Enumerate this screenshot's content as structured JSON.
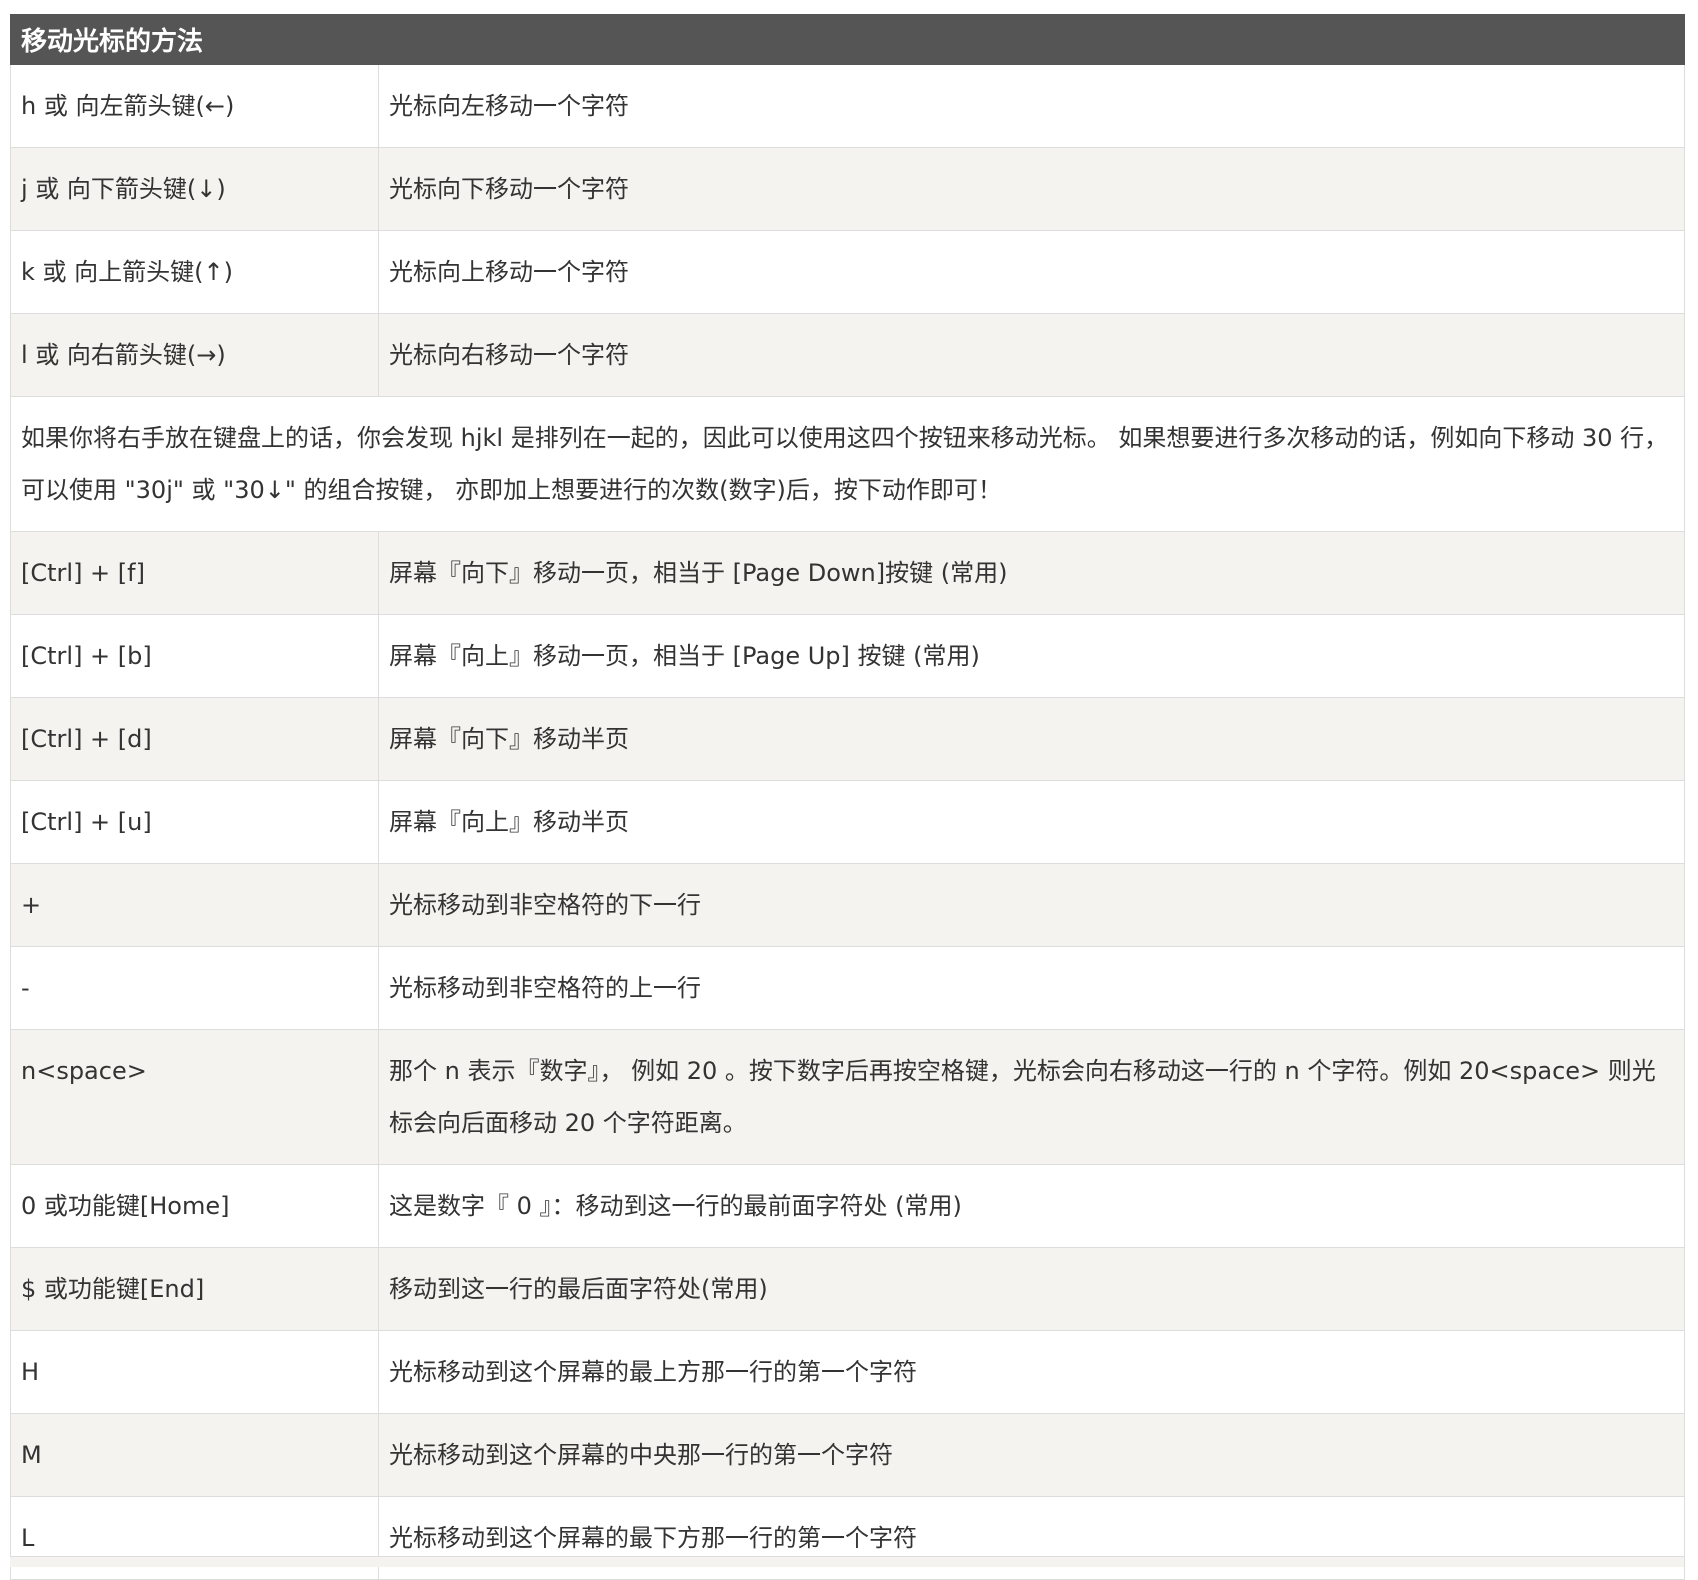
{
  "header": {
    "title": "移动光标的方法"
  },
  "rows": [
    {
      "key": "h 或 向左箭头键(←)",
      "desc": "光标向左移动一个字符"
    },
    {
      "key": "j 或 向下箭头键(↓)",
      "desc": "光标向下移动一个字符"
    },
    {
      "key": "k 或 向上箭头键(↑)",
      "desc": "光标向上移动一个字符"
    },
    {
      "key": "l 或 向右箭头键(→)",
      "desc": "光标向右移动一个字符"
    }
  ],
  "note": "如果你将右手放在键盘上的话，你会发现 hjkl 是排列在一起的，因此可以使用这四个按钮来移动光标。 如果想要进行多次移动的话，例如向下移动 30 行，可以使用 \"30j\" 或 \"30↓\" 的组合按键， 亦即加上想要进行的次数(数字)后，按下动作即可！",
  "rows2": [
    {
      "key": "[Ctrl] + [f]",
      "desc": "屏幕『向下』移动一页，相当于 [Page Down]按键 (常用)"
    },
    {
      "key": "[Ctrl] + [b]",
      "desc": "屏幕『向上』移动一页，相当于 [Page Up] 按键 (常用)"
    },
    {
      "key": "[Ctrl] + [d]",
      "desc": "屏幕『向下』移动半页"
    },
    {
      "key": "[Ctrl] + [u]",
      "desc": "屏幕『向上』移动半页"
    },
    {
      "key": "+",
      "desc": "光标移动到非空格符的下一行"
    },
    {
      "key": "-",
      "desc": "光标移动到非空格符的上一行"
    },
    {
      "key": "n<space>",
      "desc": "那个 n 表示『数字』， 例如 20 。按下数字后再按空格键，光标会向右移动这一行的 n 个字符。例如 20<space> 则光标会向后面移动 20 个字符距离。"
    },
    {
      "key": "0 或功能键[Home]",
      "desc": "这是数字『 0 』：移动到这一行的最前面字符处 (常用)"
    },
    {
      "key": "$ 或功能键[End]",
      "desc": "移动到这一行的最后面字符处(常用)"
    },
    {
      "key": "H",
      "desc": "光标移动到这个屏幕的最上方那一行的第一个字符"
    },
    {
      "key": "M",
      "desc": "光标移动到这个屏幕的中央那一行的第一个字符"
    },
    {
      "key": "L",
      "desc": "光标移动到这个屏幕的最下方那一行的第一个字符"
    }
  ]
}
